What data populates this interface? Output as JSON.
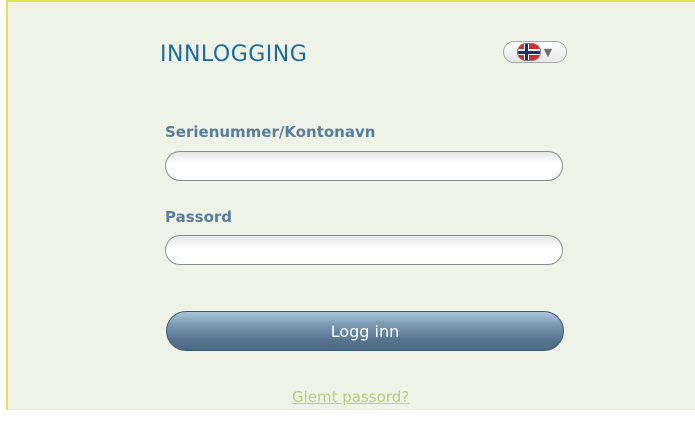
{
  "header": {
    "title": "INNLOGGING"
  },
  "language": {
    "flag_icon": "norway-flag-icon",
    "caret_icon": "caret-down-icon",
    "caret": "▼"
  },
  "form": {
    "username_label": "Serienummer/Kontonavn",
    "username_value": "",
    "password_label": "Passord",
    "password_value": "",
    "submit_label": "Logg inn",
    "forgot_label": "Glemt passord?"
  },
  "colors": {
    "title": "#1f6aa0",
    "label": "#5a7d9c",
    "panel_bg": "#eff3e7",
    "panel_border": "#e6e34a",
    "link": "#b3d17a"
  }
}
